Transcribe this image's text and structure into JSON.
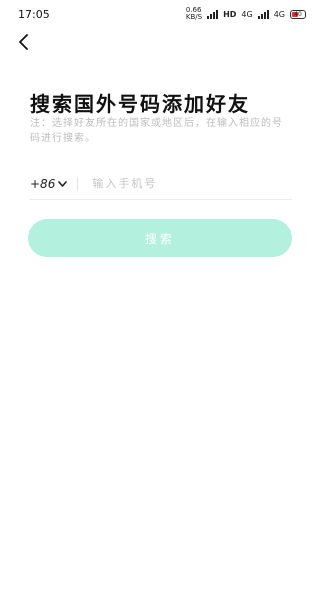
{
  "status_bar": {
    "time": "17:05",
    "net_speed_value": "0.66",
    "net_speed_unit": "KB/S",
    "hd_label": "HD",
    "network_1": "4G",
    "network_2": "4G",
    "battery_level": "40"
  },
  "header": {
    "back_icon": "chevron-left-icon"
  },
  "main": {
    "title": "搜索国外号码添加好友",
    "hint": "注：选择好友所在的国家或地区后，在输入相应的号码进行搜索。"
  },
  "form": {
    "country_code": "+86",
    "country_dropdown_icon": "chevron-down-icon",
    "phone_placeholder": "输入手机号",
    "phone_value": ""
  },
  "actions": {
    "search_label": "搜索"
  },
  "colors": {
    "button_bg": "#b3f0dd",
    "hint_text": "#bdbdbd",
    "battery_fill": "#e0302f"
  }
}
